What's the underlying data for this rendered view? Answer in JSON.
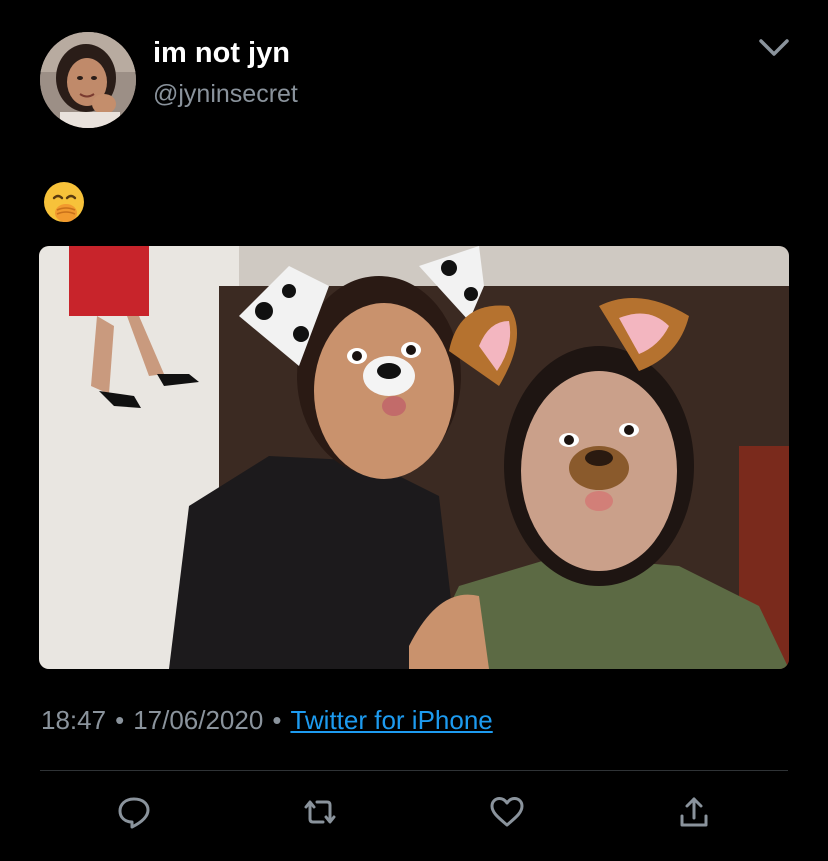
{
  "tweet": {
    "author": {
      "display_name": "im not jyn",
      "handle": "@jyninsecret",
      "avatar_icon": "user-avatar-photo"
    },
    "text_emoji": "face-with-hand-over-mouth-emoji",
    "media_icon": "tweet-photo-selfie-with-dog-filters",
    "time": "18:47",
    "separator": "•",
    "date": "17/06/2020",
    "source": "Twitter for iPhone"
  },
  "actions": [
    {
      "icon": "reply-icon"
    },
    {
      "icon": "retweet-icon"
    },
    {
      "icon": "like-icon"
    },
    {
      "icon": "share-icon"
    }
  ],
  "menu_icon": "chevron-down-icon",
  "colors": {
    "background": "#000000",
    "name_text": "#ffffff",
    "secondary_text": "#8a939c",
    "link": "#1d9bf0",
    "divider": "#2f3336"
  }
}
